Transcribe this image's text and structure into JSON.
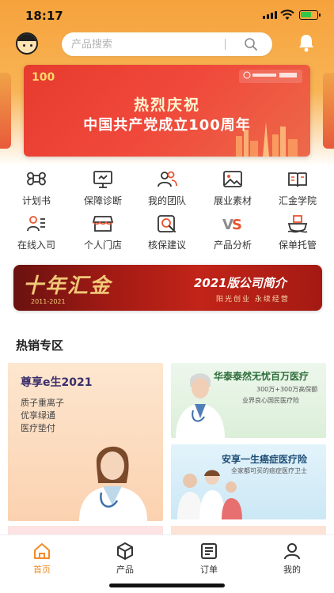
{
  "status_bar": {
    "time": "18:17"
  },
  "header": {
    "search_placeholder": "产品搜索"
  },
  "banner": {
    "line1": "热烈庆祝",
    "line2": "中国共产党成立100周年"
  },
  "quick_menu": [
    {
      "label": "计划书",
      "icon": "command-icon"
    },
    {
      "label": "保障诊断",
      "icon": "monitor-icon"
    },
    {
      "label": "我的团队",
      "icon": "team-icon"
    },
    {
      "label": "展业素材",
      "icon": "image-icon"
    },
    {
      "label": "汇金学院",
      "icon": "book-icon"
    },
    {
      "label": "在线入司",
      "icon": "user-list-icon"
    },
    {
      "label": "个人门店",
      "icon": "store-icon"
    },
    {
      "label": "核保建议",
      "icon": "search-doc-icon"
    },
    {
      "label": "产品分析",
      "icon": "vs-icon"
    },
    {
      "label": "保单托管",
      "icon": "hosting-icon"
    }
  ],
  "promo_banner": {
    "left_text": "十年汇金",
    "years": "2011-2021",
    "title": "2021版公司简介",
    "subtitle": "阳光创业  永续经营"
  },
  "hot_section": {
    "title": "热销专区",
    "cards": [
      {
        "title": "尊享e生2021",
        "features": [
          "质子重离子",
          "优享绿通",
          "医疗垫付"
        ]
      },
      {
        "title": "华泰泰然无忧百万医疗",
        "sub1": "300万+300万高保额",
        "sub2": "业界良心国民医疗险"
      },
      {
        "title": "安享一生癌症医疗险",
        "sub1": "全家都可买的癌症医疗卫士"
      }
    ]
  },
  "tabbar": [
    {
      "label": "首页",
      "icon": "home-icon",
      "active": true
    },
    {
      "label": "产品",
      "icon": "box-icon",
      "active": false
    },
    {
      "label": "订单",
      "icon": "order-icon",
      "active": false
    },
    {
      "label": "我的",
      "icon": "profile-icon",
      "active": false
    }
  ],
  "colors": {
    "accent": "#f28c28",
    "header": "#f6a23c",
    "banner_red": "#e63b2e"
  }
}
